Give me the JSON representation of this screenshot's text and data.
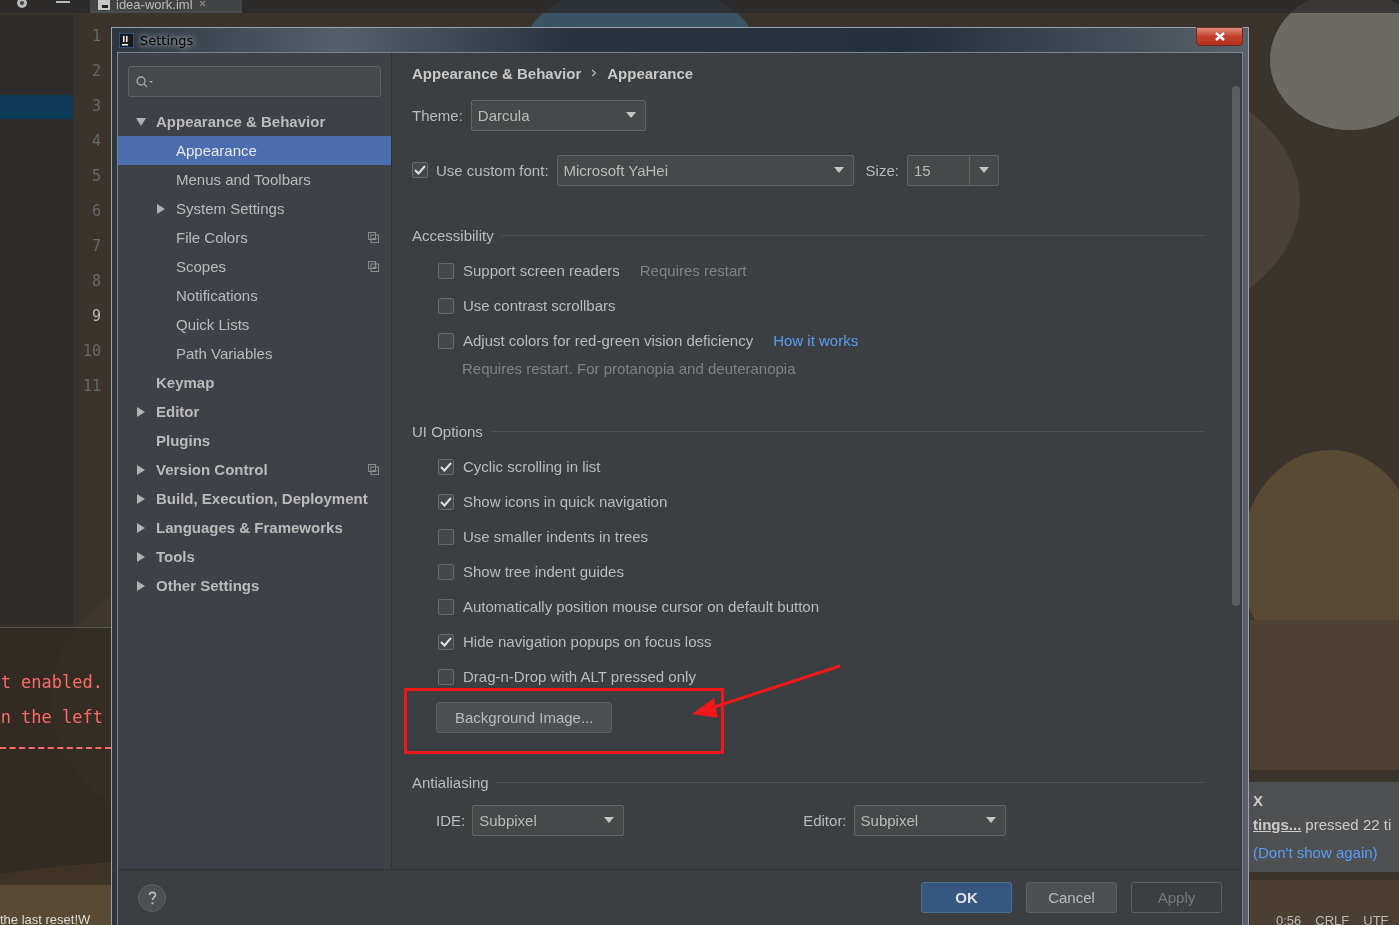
{
  "ide": {
    "tab": "idea-work.iml",
    "line_numbers": [
      {
        "number": "1",
        "selected": false
      },
      {
        "number": "2",
        "selected": false
      },
      {
        "number": "3",
        "selected": false
      },
      {
        "number": "4",
        "selected": false
      },
      {
        "number": "5",
        "selected": false
      },
      {
        "number": "6",
        "selected": false
      },
      {
        "number": "7",
        "selected": false
      },
      {
        "number": "8",
        "selected": false
      },
      {
        "number": "9",
        "selected": true
      },
      {
        "number": "10",
        "selected": false
      },
      {
        "number": "11",
        "selected": false
      }
    ],
    "console_lines": [
      "t enabled.",
      "n the left"
    ],
    "status_left": "the last reset!W",
    "notification": {
      "title": "X",
      "link": "tings...",
      "text": "pressed 22 ti",
      "action": "(Don't show again)"
    },
    "status_right": [
      "0:56",
      "CRLF",
      "UTF"
    ]
  },
  "dialog": {
    "title": "Settings",
    "tree": [
      {
        "label": "Appearance & Behavior",
        "expanded": true,
        "selected": false,
        "children": [
          {
            "label": "Appearance",
            "selected": true
          },
          {
            "label": "Menus and Toolbars",
            "selected": false
          },
          {
            "label": "System Settings",
            "expanded": false,
            "selected": false
          },
          {
            "label": "File Colors",
            "selected": false,
            "project_level": true
          },
          {
            "label": "Scopes",
            "selected": false,
            "project_level": true
          },
          {
            "label": "Notifications",
            "selected": false
          },
          {
            "label": "Quick Lists",
            "selected": false
          },
          {
            "label": "Path Variables",
            "selected": false
          }
        ]
      },
      {
        "label": "Keymap",
        "selected": false
      },
      {
        "label": "Editor",
        "expanded": false,
        "selected": false
      },
      {
        "label": "Plugins",
        "selected": false
      },
      {
        "label": "Version Control",
        "expanded": false,
        "selected": false,
        "project_level": true
      },
      {
        "label": "Build, Execution, Deployment",
        "expanded": false,
        "selected": false
      },
      {
        "label": "Languages & Frameworks",
        "expanded": false,
        "selected": false
      },
      {
        "label": "Tools",
        "expanded": false,
        "selected": false
      },
      {
        "label": "Other Settings",
        "expanded": false,
        "selected": false
      }
    ],
    "breadcrumb": [
      "Appearance & Behavior",
      "Appearance"
    ],
    "theme": {
      "label": "Theme:",
      "value": "Darcula"
    },
    "custom_font": {
      "label": "Use custom font:",
      "checked": true,
      "value": "Microsoft YaHei"
    },
    "size": {
      "label": "Size:",
      "value": "15"
    },
    "sections": [
      {
        "title": "Accessibility",
        "items": [
          {
            "kind": "checkbox",
            "label": "Support screen readers",
            "checked": false,
            "note": "Requires restart"
          },
          {
            "kind": "checkbox",
            "label": "Use contrast scrollbars",
            "checked": false
          },
          {
            "kind": "checkbox",
            "label": "Adjust colors for red-green vision deficiency",
            "checked": false,
            "link": "How it works",
            "hint": "Requires restart. For protanopia and deuteranopia"
          }
        ]
      },
      {
        "title": "UI Options",
        "items": [
          {
            "kind": "checkbox",
            "label": "Cyclic scrolling in list",
            "checked": true
          },
          {
            "kind": "checkbox",
            "label": "Show icons in quick navigation",
            "checked": true
          },
          {
            "kind": "checkbox",
            "label": "Use smaller indents in trees",
            "checked": false
          },
          {
            "kind": "checkbox",
            "label": "Show tree indent guides",
            "checked": false
          },
          {
            "kind": "checkbox",
            "label": "Automatically position mouse cursor on default button",
            "checked": false
          },
          {
            "kind": "checkbox",
            "label": "Hide navigation popups on focus loss",
            "checked": true
          },
          {
            "kind": "checkbox",
            "label": "Drag-n-Drop with ALT pressed only",
            "checked": false
          },
          {
            "kind": "button",
            "label": "Background Image..."
          }
        ]
      },
      {
        "title": "Antialiasing",
        "items": [
          {
            "kind": "selects",
            "fields": [
              {
                "label": "IDE:",
                "value": "Subpixel"
              },
              {
                "label": "Editor:",
                "value": "Subpixel"
              }
            ]
          }
        ]
      }
    ],
    "buttons": [
      {
        "label": "OK",
        "default": true,
        "disabled": false
      },
      {
        "label": "Cancel",
        "default": false,
        "disabled": false
      },
      {
        "label": "Apply",
        "default": false,
        "disabled": true
      }
    ]
  }
}
